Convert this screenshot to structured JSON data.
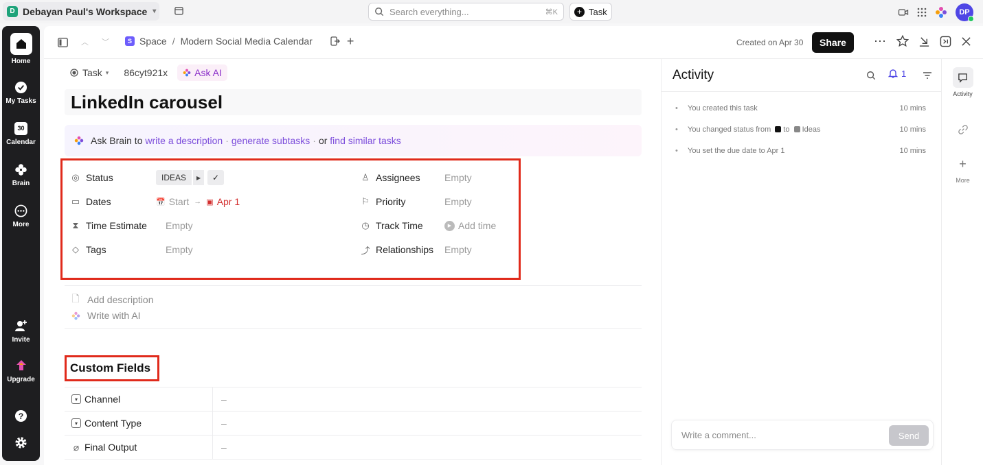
{
  "topbar": {
    "workspace_initial": "D",
    "workspace_name": "Debayan Paul's Workspace",
    "search_placeholder": "Search everything...",
    "search_shortcut": "⌘K",
    "task_button": "Task",
    "avatar_initials": "DP"
  },
  "rail": {
    "items": [
      {
        "label": "Home"
      },
      {
        "label": "My Tasks"
      },
      {
        "label": "Calendar",
        "icon_text": "30"
      },
      {
        "label": "Brain"
      },
      {
        "label": "More"
      },
      {
        "label": "Invite"
      },
      {
        "label": "Upgrade"
      }
    ]
  },
  "header": {
    "space_initial": "S",
    "breadcrumb_space": "Space",
    "breadcrumb_sep": "/",
    "breadcrumb_list": "Modern Social Media Calendar",
    "created": "Created on Apr 30",
    "share": "Share"
  },
  "task": {
    "type": "Task",
    "id": "86cyt921x",
    "ask_ai": "Ask AI",
    "title": "LinkedIn carousel"
  },
  "brain": {
    "prefix": "Ask Brain to",
    "link1": "write a description",
    "dot1": "·",
    "link2": "generate subtasks",
    "dot2": "·",
    "or": "or",
    "link3": "find similar tasks"
  },
  "fields": {
    "status_label": "Status",
    "status_value": "IDEAS",
    "dates_label": "Dates",
    "start": "Start",
    "arrow": "→",
    "due": "Apr 1",
    "time_estimate_label": "Time Estimate",
    "time_estimate_value": "Empty",
    "tags_label": "Tags",
    "tags_value": "Empty",
    "assignees_label": "Assignees",
    "assignees_value": "Empty",
    "priority_label": "Priority",
    "priority_value": "Empty",
    "track_time_label": "Track Time",
    "track_time_value": "Add time",
    "relationships_label": "Relationships",
    "relationships_value": "Empty"
  },
  "description": {
    "add": "Add description",
    "write_ai": "Write with AI"
  },
  "custom_fields": {
    "title": "Custom Fields",
    "rows": [
      {
        "name": "Channel",
        "value": "–"
      },
      {
        "name": "Content Type",
        "value": "–"
      },
      {
        "name": "Final Output",
        "value": "–"
      }
    ]
  },
  "activity": {
    "title": "Activity",
    "notif_count": "1",
    "items": [
      {
        "text": "You created this task",
        "time": "10 mins"
      },
      {
        "text_a": "You changed status from",
        "text_b": "to",
        "text_c": "Ideas",
        "time": "10 mins"
      },
      {
        "text": "You set the due date to Apr 1",
        "time": "10 mins"
      }
    ],
    "comment_placeholder": "Write a comment...",
    "send": "Send"
  },
  "right_sidebar": {
    "activity": "Activity",
    "more": "More"
  },
  "colors": {
    "highlight_box": "#e02a1b",
    "brand": "#7c4ddb",
    "due_red": "#d32f2f"
  }
}
